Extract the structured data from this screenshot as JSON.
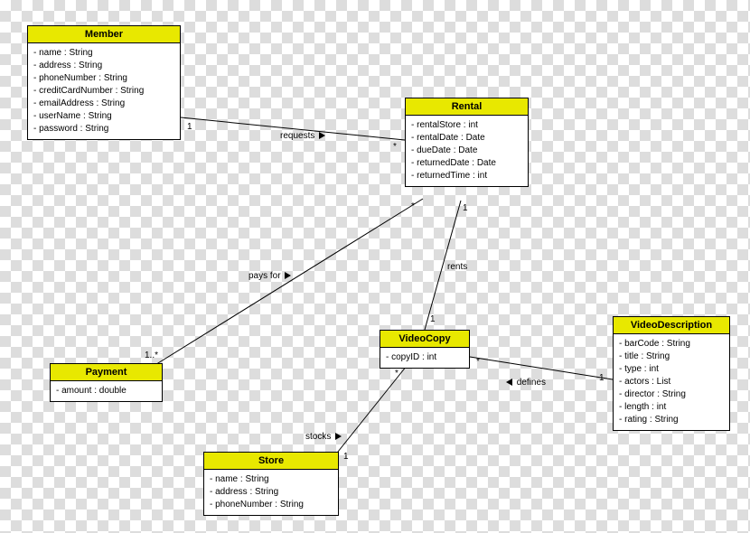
{
  "classes": {
    "member": {
      "name": "Member",
      "attrs": [
        "- name : String",
        "- address : String",
        "- phoneNumber : String",
        "- creditCardNumber : String",
        "- emailAddress : String",
        "- userName : String",
        "- password : String"
      ]
    },
    "rental": {
      "name": "Rental",
      "attrs": [
        "- rentalStore : int",
        "- rentalDate : Date",
        "- dueDate : Date",
        "- returnedDate : Date",
        "- returnedTime : int"
      ]
    },
    "payment": {
      "name": "Payment",
      "attrs": [
        "- amount : double"
      ]
    },
    "videocopy": {
      "name": "VideoCopy",
      "attrs": [
        "- copyID : int"
      ]
    },
    "videodescription": {
      "name": "VideoDescription",
      "attrs": [
        "- barCode : String",
        "- title : String",
        "- type : int",
        "- actors : List",
        "- director : String",
        "- length : int",
        "- rating : String"
      ]
    },
    "store": {
      "name": "Store",
      "attrs": [
        "- name : String",
        "- address : String",
        "- phoneNumber : String"
      ]
    }
  },
  "associations": {
    "requests": {
      "label": "requests",
      "end1": "1",
      "end2": "*"
    },
    "paysfor": {
      "label": "pays for",
      "end1": "1..*",
      "end2": "*"
    },
    "rents": {
      "label": "rents",
      "end1": "1",
      "end2": "1"
    },
    "defines": {
      "label": "defines",
      "end1": "*",
      "end2": "1"
    },
    "stocks": {
      "label": "stocks",
      "end1": "*",
      "end2": "1"
    }
  }
}
